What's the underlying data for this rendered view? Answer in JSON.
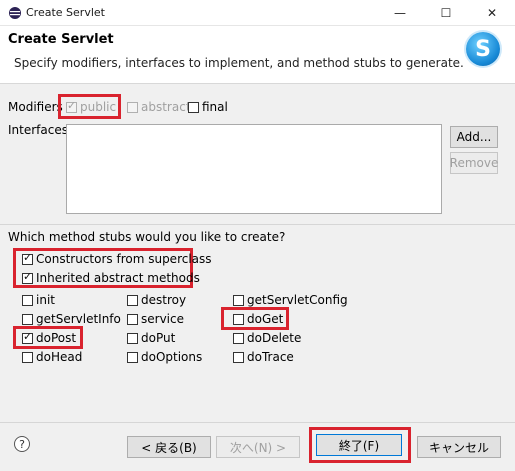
{
  "window": {
    "title": "Create Servlet",
    "minimize": "—",
    "maximize": "☐",
    "close": "✕"
  },
  "header": {
    "title": "Create Servlet",
    "description": "Specify modifiers, interfaces to implement, and method stubs to generate.",
    "badge": "S"
  },
  "modifiers": {
    "label": "Modifiers",
    "public": {
      "label": "public",
      "checked": true,
      "enabled": false
    },
    "abstract": {
      "label": "abstract",
      "checked": false,
      "enabled": false
    },
    "final": {
      "label": "final",
      "checked": false,
      "enabled": true
    }
  },
  "interfaces": {
    "label": "Interfaces:",
    "add": "Add...",
    "remove": "Remove"
  },
  "stubs": {
    "question": "Which method stubs would you like to create?",
    "constructors": {
      "label": "Constructors from superclass",
      "checked": true
    },
    "inherited": {
      "label": "Inherited abstract methods",
      "checked": true
    },
    "methods": [
      {
        "label": "init",
        "checked": false
      },
      {
        "label": "destroy",
        "checked": false
      },
      {
        "label": "getServletConfig",
        "checked": false
      },
      {
        "label": "getServletInfo",
        "checked": false
      },
      {
        "label": "service",
        "checked": false
      },
      {
        "label": "doGet",
        "checked": false
      },
      {
        "label": "doPost",
        "checked": true
      },
      {
        "label": "doPut",
        "checked": false
      },
      {
        "label": "doDelete",
        "checked": false
      },
      {
        "label": "doHead",
        "checked": false
      },
      {
        "label": "doOptions",
        "checked": false
      },
      {
        "label": "doTrace",
        "checked": false
      }
    ]
  },
  "footer": {
    "help": "?",
    "back": "< 戻る(B)",
    "next": "次へ(N) >",
    "finish": "終了(F)",
    "cancel": "キャンセル"
  }
}
